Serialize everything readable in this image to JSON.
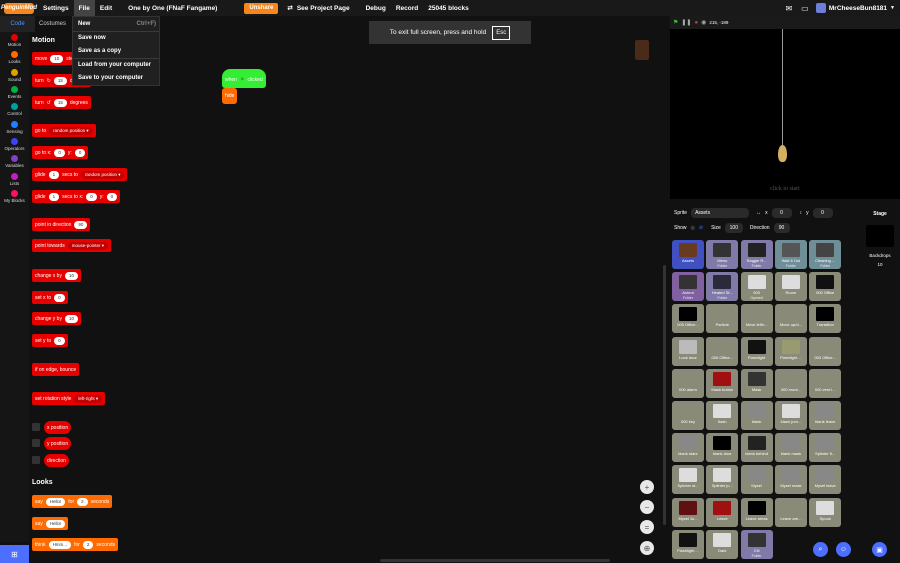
{
  "topbar": {
    "logo": "PenguinMod",
    "settings": "Settings",
    "file": "File",
    "edit": "Edit",
    "project_title": "One by One (FNaF Fangame)",
    "unshare": "Unshare",
    "see_project_page": "See Project Page",
    "debug": "Debug",
    "record": "Record",
    "block_count": "25045 blocks",
    "username": "MrCheeseBun8181"
  },
  "file_menu": {
    "items": [
      "New",
      "Save now",
      "Save as a copy",
      "Load from your computer",
      "Save to your computer"
    ],
    "shortcut": "Ctrl+F)"
  },
  "tabs": {
    "code": "Code",
    "costumes": "Costumes"
  },
  "categories": [
    {
      "label": "Motion",
      "color": "#e60000"
    },
    {
      "label": "Looks",
      "color": "#ff6b00"
    },
    {
      "label": "Sound",
      "color": "#e0a000"
    },
    {
      "label": "Events",
      "color": "#00b040"
    },
    {
      "label": "Control",
      "color": "#00a0a0"
    },
    {
      "label": "Sensing",
      "color": "#2080ff"
    },
    {
      "label": "Operators",
      "color": "#4040ff"
    },
    {
      "label": "Variables",
      "color": "#8040c0"
    },
    {
      "label": "Lists",
      "color": "#c020c0"
    },
    {
      "label": "My Blocks",
      "color": "#ff1060"
    }
  ],
  "palette": {
    "motion_header": "Motion",
    "looks_header": "Looks",
    "move": {
      "a": "move",
      "v": "10",
      "b": "steps"
    },
    "turn_r": {
      "a": "turn",
      "v": "15",
      "b": "degrees"
    },
    "turn_l": {
      "a": "turn",
      "v": "15",
      "b": "degrees"
    },
    "goto": {
      "a": "go to",
      "dd": "random position"
    },
    "gotoxy": {
      "a": "go to x:",
      "x": "0",
      "b": "y:",
      "y": "0"
    },
    "glide": {
      "a": "glide",
      "v": "1",
      "b": "secs to",
      "dd": "random position"
    },
    "glidexy": {
      "a": "glide",
      "v": "1",
      "b": "secs to x:",
      "x": "0",
      "c": "y:",
      "y": "0"
    },
    "point_dir": {
      "a": "point in direction",
      "v": "90"
    },
    "point_towards": {
      "a": "point towards",
      "dd": "mouse-pointer"
    },
    "change_x": {
      "a": "change x by",
      "v": "10"
    },
    "set_x": {
      "a": "set x to",
      "v": "0"
    },
    "change_y": {
      "a": "change y by",
      "v": "10"
    },
    "set_y": {
      "a": "set y to",
      "v": "0"
    },
    "bounce": "if on edge, bounce",
    "rot_style": {
      "a": "set rotation style",
      "dd": "left-right"
    },
    "x_pos": "x position",
    "y_pos": "y position",
    "direction": "direction",
    "say_for": {
      "a": "say",
      "v": "Hello!",
      "b": "for",
      "n": "2",
      "c": "seconds"
    },
    "say": {
      "a": "say",
      "v": "Hello!"
    },
    "think_for": {
      "a": "think",
      "v": "Hmm...",
      "b": "for",
      "n": "2",
      "c": "seconds"
    }
  },
  "fullscreen_notice": {
    "text": "To exit full screen, press and hold",
    "key": "Esc"
  },
  "workspace": {
    "hat_a": "when",
    "hat_b": "clicked",
    "hide": "hide"
  },
  "stage": {
    "coords": "215, -189",
    "click_to_start": "click to start"
  },
  "sprite_info": {
    "sprite_label": "Sprite",
    "sprite_name": "Assets",
    "x_label": "x",
    "x": "0",
    "y_label": "y",
    "y": "0",
    "show_label": "Show",
    "size_label": "Size",
    "size": "100",
    "direction_label": "Direction",
    "direction": "90"
  },
  "stage_panel": {
    "label": "Stage",
    "backdrops_label": "Backdrops",
    "backdrops_count": "10"
  },
  "sprites": [
    {
      "name": "Assets",
      "kind": "",
      "style": "sel",
      "thumb": "#6a3a20"
    },
    {
      "name": "Menu",
      "kind": "Folder",
      "style": "folder",
      "thumb": "#333"
    },
    {
      "name": "Raggie R...",
      "kind": "Folder",
      "style": "folder",
      "thumb": "#222"
    },
    {
      "name": "Wait it Out",
      "kind": "Folder",
      "style": "folder2",
      "thumb": "#555"
    },
    {
      "name": "Cleaning ...",
      "kind": "Folder",
      "style": "folder2",
      "thumb": "#444"
    },
    {
      "name": "Ashrot",
      "kind": "Folder",
      "style": "ppl",
      "thumb": "#333"
    },
    {
      "name": "Heated St...",
      "kind": "Folder",
      "style": "folder",
      "thumb": "#2a2a3a"
    },
    {
      "name": "000",
      "kind": "Opened",
      "style": "",
      "thumb": "#ddd"
    },
    {
      "name": "Room",
      "kind": "",
      "style": "",
      "thumb": "#ddd"
    },
    {
      "name": "000 Office",
      "kind": "",
      "style": "",
      "thumb": "#111"
    },
    {
      "name": "000 Office...",
      "kind": "",
      "style": "",
      "thumb": "#000"
    },
    {
      "name": "Particle",
      "kind": "",
      "style": "",
      "thumb": "#8a8a78"
    },
    {
      "name": "Move left/r...",
      "kind": "",
      "style": "",
      "thumb": "#8a8a78"
    },
    {
      "name": "Move up/d...",
      "kind": "",
      "style": "",
      "thumb": "#8a8a78"
    },
    {
      "name": "Transition",
      "kind": "",
      "style": "",
      "thumb": "#000"
    },
    {
      "name": "Look door",
      "kind": "",
      "style": "",
      "thumb": "#bbb"
    },
    {
      "name": "000 Office...",
      "kind": "",
      "style": "",
      "thumb": "#8a8a78"
    },
    {
      "name": "Flashlight",
      "kind": "",
      "style": "",
      "thumb": "#111"
    },
    {
      "name": "Flashlight ...",
      "kind": "",
      "style": "",
      "thumb": "#9a9a70"
    },
    {
      "name": "000 Office...",
      "kind": "",
      "style": "",
      "thumb": "#8a8a78"
    },
    {
      "name": "000 alarm",
      "kind": "",
      "style": "",
      "thumb": "#8a8a78"
    },
    {
      "name": "Mask button",
      "kind": "",
      "style": "",
      "thumb": "#a01010"
    },
    {
      "name": "Mask",
      "kind": "",
      "style": "",
      "thumb": "#333"
    },
    {
      "name": "000 mont...",
      "kind": "",
      "style": "",
      "thumb": "#8a8a78"
    },
    {
      "name": "000 vent l...",
      "kind": "",
      "style": "",
      "thumb": "#8a8a78"
    },
    {
      "name": "000 key",
      "kind": "",
      "style": "",
      "thumb": "#8a8a78"
    },
    {
      "name": "flash",
      "kind": "",
      "style": "",
      "thumb": "#ddd"
    },
    {
      "name": "blank",
      "kind": "",
      "style": "",
      "thumb": "#888"
    },
    {
      "name": "blank jum...",
      "kind": "",
      "style": "",
      "thumb": "#ddd"
    },
    {
      "name": "blank leave",
      "kind": "",
      "style": "",
      "thumb": "#888"
    },
    {
      "name": "blank stare",
      "kind": "",
      "style": "",
      "thumb": "#888"
    },
    {
      "name": "blank door",
      "kind": "",
      "style": "",
      "thumb": "#000"
    },
    {
      "name": "blank behind",
      "kind": "",
      "style": "",
      "thumb": "#222"
    },
    {
      "name": "blank mask",
      "kind": "",
      "style": "",
      "thumb": "#888"
    },
    {
      "name": "Splinter fl...",
      "kind": "",
      "style": "",
      "thumb": "#888"
    },
    {
      "name": "Splinter st...",
      "kind": "",
      "style": "",
      "thumb": "#ddd"
    },
    {
      "name": "Splinter ju...",
      "kind": "",
      "style": "",
      "thumb": "#ddd"
    },
    {
      "name": "Mysel",
      "kind": "",
      "style": "",
      "thumb": "#888"
    },
    {
      "name": "Mysel mask",
      "kind": "",
      "style": "",
      "thumb": "#888"
    },
    {
      "name": "Mysel leave",
      "kind": "",
      "style": "",
      "thumb": "#888"
    },
    {
      "name": "Mysel Ju...",
      "kind": "",
      "style": "",
      "thumb": "#601010"
    },
    {
      "name": "Leave",
      "kind": "",
      "style": "",
      "thumb": "#a01010"
    },
    {
      "name": "Leave areas",
      "kind": "",
      "style": "",
      "thumb": "#000"
    },
    {
      "name": "Leave are...",
      "kind": "",
      "style": "",
      "thumb": "#8a8a78"
    },
    {
      "name": "Spook",
      "kind": "",
      "style": "",
      "thumb": "#ddd"
    },
    {
      "name": "Flashlight ...",
      "kind": "",
      "style": "",
      "thumb": "#111"
    },
    {
      "name": "Dark",
      "kind": "",
      "style": "",
      "thumb": "#ddd"
    },
    {
      "name": "CN",
      "kind": "Folder",
      "style": "folder",
      "thumb": "#333"
    }
  ],
  "colors": {
    "accent": "#f7861b",
    "motion": "#e60000",
    "looks": "#ff6b00",
    "events": "#33ff33",
    "blue": "#4c6fff"
  }
}
